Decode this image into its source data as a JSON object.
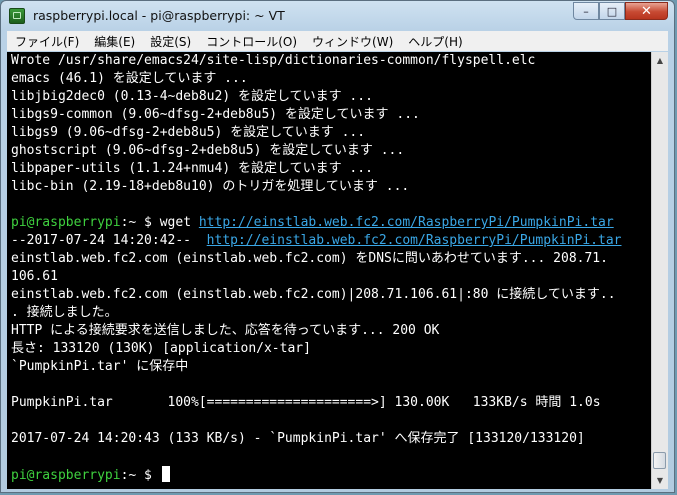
{
  "window": {
    "title": "raspberrypi.local - pi@raspberrypi: ~ VT",
    "icon": "terminal-app-icon",
    "buttons": {
      "minimize": "–",
      "maximize": "□",
      "close": "✕"
    }
  },
  "menu": [
    "ファイル(F)",
    "編集(E)",
    "設定(S)",
    "コントロール(O)",
    "ウィンドウ(W)",
    "ヘルプ(H)"
  ],
  "terminal": {
    "colors": {
      "background": "#000000",
      "text": "#ffffff",
      "prompt": "#3fd13f",
      "link": "#3aa7e6"
    },
    "lines": [
      "Wrote /usr/share/emacs24/site-lisp/dictionaries-common/flyspell.elc",
      "emacs (46.1) を設定しています ...",
      "libjbig2dec0 (0.13-4~deb8u2) を設定しています ...",
      "libgs9-common (9.06~dfsg-2+deb8u5) を設定しています ...",
      "libgs9 (9.06~dfsg-2+deb8u5) を設定しています ...",
      "ghostscript (9.06~dfsg-2+deb8u5) を設定しています ...",
      "libpaper-utils (1.1.24+nmu4) を設定しています ...",
      "libc-bin (2.19-18+deb8u10) のトリガを処理しています ...",
      "",
      "",
      "",
      "einstlab.web.fc2.com (einstlab.web.fc2.com) をDNSに問いあわせています... 208.71.",
      "106.61",
      "einstlab.web.fc2.com (einstlab.web.fc2.com)|208.71.106.61|:80 に接続しています..",
      ". 接続しました。",
      "HTTP による接続要求を送信しました、応答を待っています... 200 OK",
      "長さ: 133120 (130K) [application/x-tar]",
      "`PumpkinPi.tar' に保存中",
      "",
      "PumpkinPi.tar       100%[=====================>] 130.00K   133KB/s 時間 1.0s",
      "",
      "2017-07-24 14:20:43 (133 KB/s) - `PumpkinPi.tar' へ保存完了 [133120/133120]",
      "",
      ""
    ],
    "prompt_user": "pi@raspberrypi",
    "prompt_path": ":~ $",
    "wget_command": "wget ",
    "wget_url": "http://einstlab.web.fc2.com/RaspberryPi/PumpkinPi.tar",
    "wget_timestamp": "--2017-07-24 14:20:42--  ",
    "wget_url_2": "http://einstlab.web.fc2.com/RaspberryPi/PumpkinPi.tar"
  }
}
